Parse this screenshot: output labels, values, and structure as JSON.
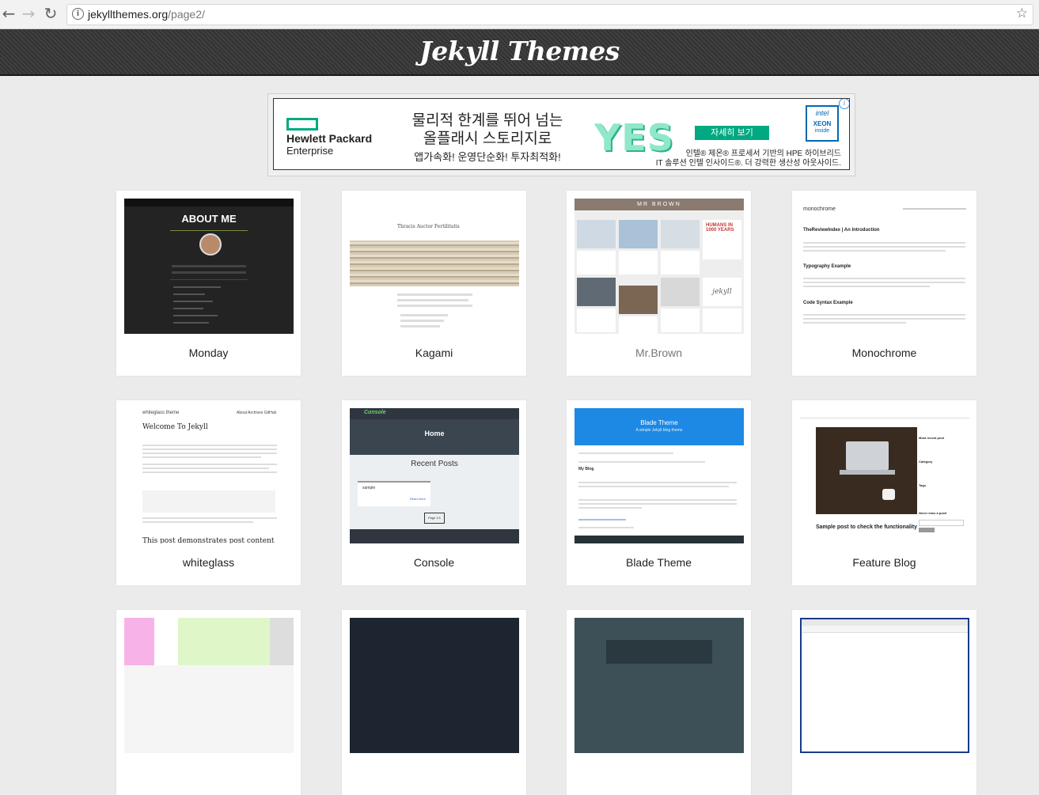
{
  "browser": {
    "url_domain": "jekyllthemes.org",
    "url_path": "/page2/",
    "icons": {
      "back": "back-arrow-icon",
      "forward": "forward-arrow-icon",
      "reload": "reload-icon",
      "info": "info-icon",
      "bookmark": "star-icon"
    }
  },
  "header": {
    "title": "Jekyll Themes"
  },
  "ad": {
    "brand_line1": "Hewlett Packard",
    "brand_line2": "Enterprise",
    "headline_line1": "물리적 한계를 뛰어 넘는",
    "headline_line2": "올플래시 스토리지로",
    "subline": "앱가속화! 운영단순화! 투자최적화!",
    "yes_text": "YES",
    "cta": "자세히 보기",
    "desc_line1": "인텔® 제온® 프로세서 기반의 HPE 하이브리드",
    "desc_line2": "IT 솔루션 인텔 인사이드®. 더 강력한 생산성 아웃사이드.",
    "intel_badge": {
      "l1": "intel",
      "l2": "XEON",
      "l3": "inside"
    },
    "accent": "#01a982"
  },
  "themes": [
    {
      "name": "Monday",
      "muted": false,
      "preview": {
        "heading": "ABOUT ME"
      }
    },
    {
      "name": "Kagami",
      "muted": false,
      "preview": {
        "heading": "Thracis Auctor Fertilitatis"
      }
    },
    {
      "name": "Mr.Brown",
      "muted": true,
      "preview": {
        "heading": "MR BROWN",
        "tile_text_1": "HUMANS IN 1000 YEARS",
        "tile_text_2": "jekyll"
      }
    },
    {
      "name": "Monochrome",
      "muted": false,
      "preview": {
        "brand": "monochrome",
        "post1": "TheReviewIndex | An Introduction",
        "post2": "Typography Example",
        "post3": "Code Syntax Example"
      }
    },
    {
      "name": "whiteglass",
      "muted": false,
      "preview": {
        "brand": "whiteglass theme",
        "nav": "About  Archives  GitHub",
        "post": "Welcome To Jekyll",
        "footer_heading": "This post demonstrates post content"
      }
    },
    {
      "name": "Console",
      "muted": false,
      "preview": {
        "brand": "Console",
        "home": "Home",
        "section": "Recent Posts",
        "post": "sample",
        "readmore": "Read more",
        "button": "Page 1/1"
      }
    },
    {
      "name": "Blade Theme",
      "muted": false,
      "preview": {
        "title": "Blade Theme",
        "subtitle": "A simple Jekyll blog theme",
        "section": "My Blog"
      }
    },
    {
      "name": "Feature Blog",
      "muted": false,
      "preview": {
        "caption": "Sample post to check the functionality",
        "side1": "Most recent post",
        "side2": "Category",
        "side3": "Tags",
        "side4": "Never miss a post!"
      }
    }
  ],
  "colors": {
    "page_bg": "#ebebeb",
    "header_bg": "#3a3a3a",
    "card_bg": "#ffffff"
  }
}
